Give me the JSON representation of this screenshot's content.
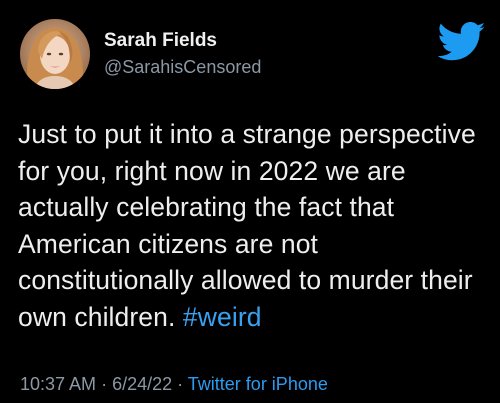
{
  "user": {
    "display_name": "Sarah Fields",
    "handle": "@SarahisCensored"
  },
  "tweet": {
    "text": "Just to put it into a strange perspective for you, right now in 2022 we are actually celebrating the fact that American citizens are not constitutionally allowed to murder their own children.",
    "hashtag": "#weird"
  },
  "meta": {
    "time": "10:37 AM",
    "separator": " · ",
    "date": "6/24/22",
    "source": "Twitter for iPhone"
  },
  "icons": {
    "brand": "twitter-bird-icon"
  },
  "colors": {
    "background": "#000000",
    "text": "#e7e9ea",
    "secondary_text": "#8b98a5",
    "link": "#1d9bf0",
    "brand": "#1d9bf0"
  }
}
